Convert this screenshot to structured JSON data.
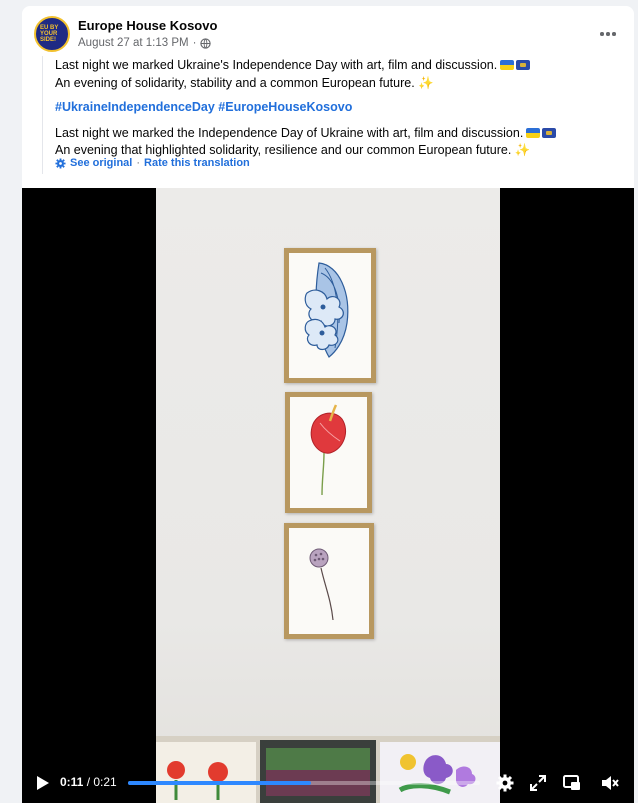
{
  "post": {
    "page_name": "Europe House Kosovo",
    "avatar_text": "EU BY YOUR SIDE!",
    "date": "August 27 at 1:13 PM",
    "separator": "·",
    "audience_icon": "globe-icon",
    "more_icon": "more-options-icon",
    "text_line1": "Last night we marked Ukraine's Independence Day with art, film and discussion.",
    "text_line2": "An evening of solidarity, stability and a common European future.",
    "hashtag1": "#UkraineIndependenceDay",
    "hashtag2": "#EuropeHouseKosovo",
    "translated_line1": "Last night we marked the Independence Day of Ukraine with art, film and discussion.",
    "translated_line2": "An evening that highlighted solidarity, resilience and our common European future.",
    "sparkle": "✨",
    "see_original": "See original",
    "rate_translation": "Rate this translation"
  },
  "video": {
    "current_time": "0:11",
    "total_time": "0:21",
    "time_separator": " / ",
    "progress": 0.52,
    "accent_color": "#2d88ff"
  },
  "colors": {
    "link": "#216fdb",
    "secondary_text": "#65676b",
    "frame_wood": "#b89860"
  }
}
